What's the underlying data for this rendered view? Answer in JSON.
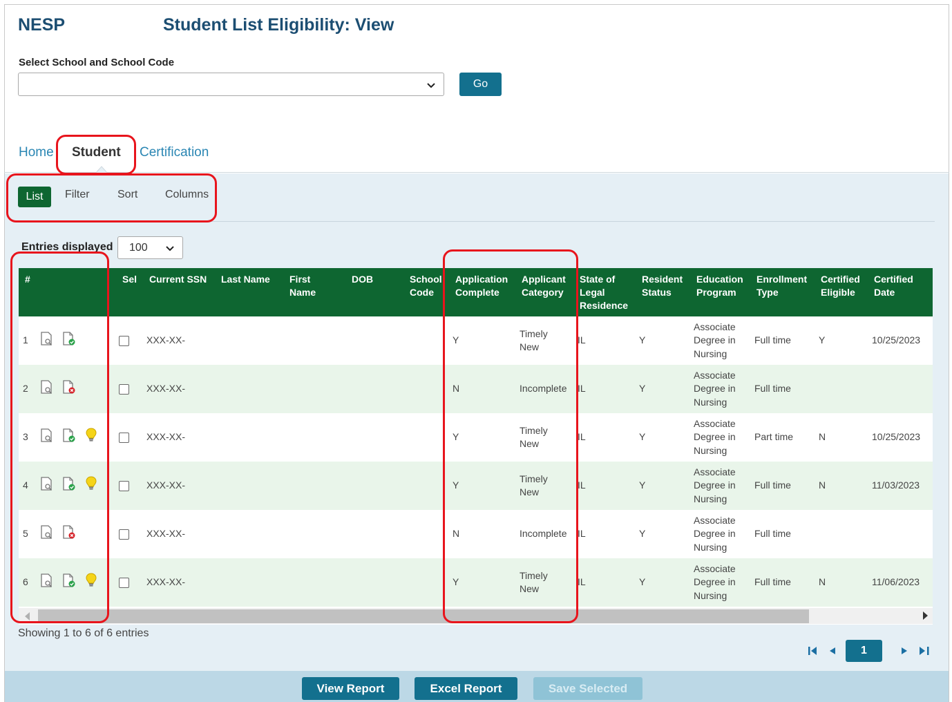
{
  "brand": "NESP",
  "page_title": "Student List Eligibility: View",
  "school_select": {
    "label": "Select School and School Code",
    "value": ""
  },
  "go_label": "Go",
  "tabs": [
    {
      "label": "Home",
      "active": false
    },
    {
      "label": "Student",
      "active": true
    },
    {
      "label": "Certification",
      "active": false
    }
  ],
  "subtabs": [
    {
      "label": "List",
      "active": true
    },
    {
      "label": "Filter",
      "active": false
    },
    {
      "label": "Sort",
      "active": false
    },
    {
      "label": "Columns",
      "active": false
    }
  ],
  "entries": {
    "label": "Entries displayed",
    "value": "100"
  },
  "table": {
    "headers": [
      "#",
      "Sel",
      "Current SSN",
      "Last Name",
      "First\nName",
      "DOB",
      "School\nCode",
      "Application\nComplete",
      "Applicant\nCategory",
      "State of\nLegal\nResidence",
      "Resident\nStatus",
      "Education\nProgram",
      "Enrollment\nType",
      "Certified\nEligible",
      "Certified\nDate"
    ],
    "rows": [
      {
        "num": "1",
        "status_icon": "doc-check-icon",
        "bulb": false,
        "ssn": "XXX-XX-",
        "app_complete": "Y",
        "category": "Timely\nNew",
        "state": "IL",
        "resident": "Y",
        "program": "Associate\nDegree in\nNursing",
        "enrollment": "Full time",
        "eligible": "Y",
        "date": "10/25/2023"
      },
      {
        "num": "2",
        "status_icon": "doc-x-icon",
        "bulb": false,
        "ssn": "XXX-XX-",
        "app_complete": "N",
        "category": "Incomplete",
        "state": "IL",
        "resident": "Y",
        "program": "Associate\nDegree in\nNursing",
        "enrollment": "Full time",
        "eligible": "",
        "date": ""
      },
      {
        "num": "3",
        "status_icon": "doc-check-icon",
        "bulb": true,
        "ssn": "XXX-XX-",
        "app_complete": "Y",
        "category": "Timely\nNew",
        "state": "IL",
        "resident": "Y",
        "program": "Associate\nDegree in\nNursing",
        "enrollment": "Part time",
        "eligible": "N",
        "date": "10/25/2023"
      },
      {
        "num": "4",
        "status_icon": "doc-check-icon",
        "bulb": true,
        "ssn": "XXX-XX-",
        "app_complete": "Y",
        "category": "Timely\nNew",
        "state": "IL",
        "resident": "Y",
        "program": "Associate\nDegree in\nNursing",
        "enrollment": "Full time",
        "eligible": "N",
        "date": "11/03/2023"
      },
      {
        "num": "5",
        "status_icon": "doc-x-icon",
        "bulb": false,
        "ssn": "XXX-XX-",
        "app_complete": "N",
        "category": "Incomplete",
        "state": "IL",
        "resident": "Y",
        "program": "Associate\nDegree in\nNursing",
        "enrollment": "Full time",
        "eligible": "",
        "date": ""
      },
      {
        "num": "6",
        "status_icon": "doc-check-icon",
        "bulb": true,
        "ssn": "XXX-XX-",
        "app_complete": "Y",
        "category": "Timely\nNew",
        "state": "IL",
        "resident": "Y",
        "program": "Associate\nDegree in\nNursing",
        "enrollment": "Full time",
        "eligible": "N",
        "date": "11/06/2023"
      }
    ]
  },
  "showing": "Showing 1 to 6 of 6 entries",
  "pager": {
    "current": "1"
  },
  "footer_buttons": [
    {
      "label": "View Report",
      "enabled": true
    },
    {
      "label": "Excel Report",
      "enabled": true
    },
    {
      "label": "Save Selected",
      "enabled": false
    }
  ],
  "colors": {
    "header_blue": "#1c4e72",
    "accent_teal": "#13708e",
    "table_green": "#0e6631",
    "link_blue": "#2a86b3",
    "highlight_red": "#e8141c"
  }
}
